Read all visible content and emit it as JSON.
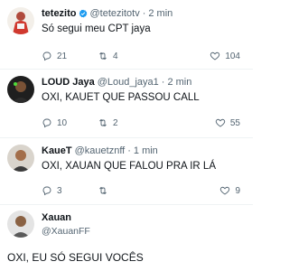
{
  "tweets": [
    {
      "name": "tetezito",
      "handle": "@tetezitotv",
      "dot": "·",
      "time": "2 min",
      "text": "Só segui meu CPT jaya",
      "replies": "21",
      "retweets": "4",
      "likes": "104"
    },
    {
      "name": "LOUD Jaya",
      "handle": "@Loud_jaya1",
      "dot": "·",
      "time": "2 min",
      "text": "OXI, KAUET QUE PASSOU CALL",
      "replies": "10",
      "retweets": "2",
      "likes": "55"
    },
    {
      "name": "KaueT",
      "handle": "@kauetznff",
      "dot": "·",
      "time": "1 min",
      "text": "OXI, XAUAN QUE FALOU PRA IR LÁ",
      "replies": "3",
      "retweets": "",
      "likes": "9"
    }
  ],
  "final_tweet": {
    "name": "Xauan",
    "handle": "@XauanFF",
    "text": "OXI, EU SÓ SEGUI VOCÊS"
  },
  "colors": {
    "text": "#0f1419",
    "secondary": "#536471",
    "verified": "#1d9bf0",
    "separator": "#eff3f4"
  },
  "icons": [
    "reply-icon",
    "retweet-icon",
    "like-icon",
    "verified-icon"
  ]
}
